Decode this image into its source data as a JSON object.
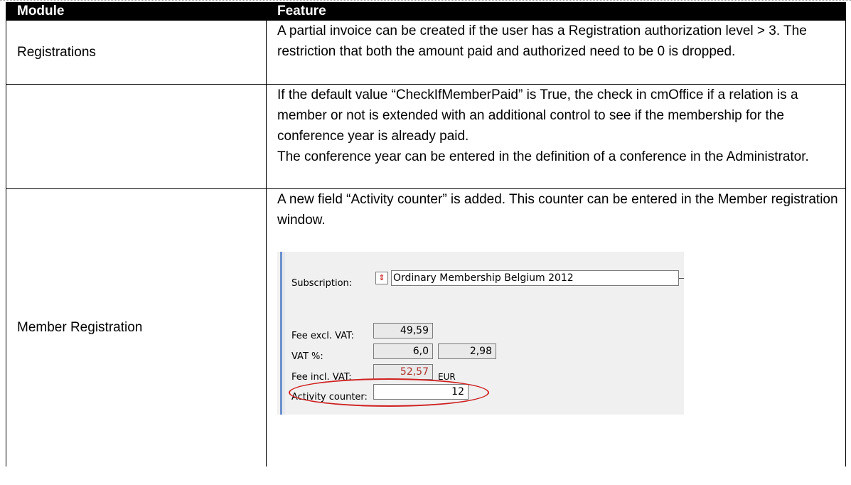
{
  "header": {
    "col1": "Module",
    "col2": "Feature"
  },
  "rows": [
    {
      "module": "Registrations",
      "feature": [
        "A partial invoice can be created if the user has a Registration authorization level > 3. The restriction that both the amount paid and authorized need to be 0 is dropped."
      ]
    },
    {
      "module": "",
      "feature": [
        "If the default value “CheckIfMemberPaid” is True, the check in cmOffice if a relation is a member or not is extended with an additional control to see if the membership for the conference year is already paid.",
        "The conference year can be entered in the definition of a conference in the Administrator."
      ]
    },
    {
      "module": "Member Registration",
      "feature": [
        "A new field “Activity counter” is added.  This counter can be entered in the Member registration window."
      ]
    }
  ],
  "screenshot": {
    "subscription_label": "Subscription:",
    "subscription_value": "Ordinary Membership Belgium 2012",
    "fee_excl_label": "Fee excl. VAT:",
    "fee_excl_value": "49,59",
    "vat_pct_label": "VAT %:",
    "vat_pct_value": "6,0",
    "vat_amount_value": "2,98",
    "fee_incl_label": "Fee incl. VAT:",
    "fee_incl_value": "52,57",
    "currency": "EUR",
    "activity_label": "Activity counter:",
    "activity_value": "12",
    "highlight_color": "#d02020"
  }
}
